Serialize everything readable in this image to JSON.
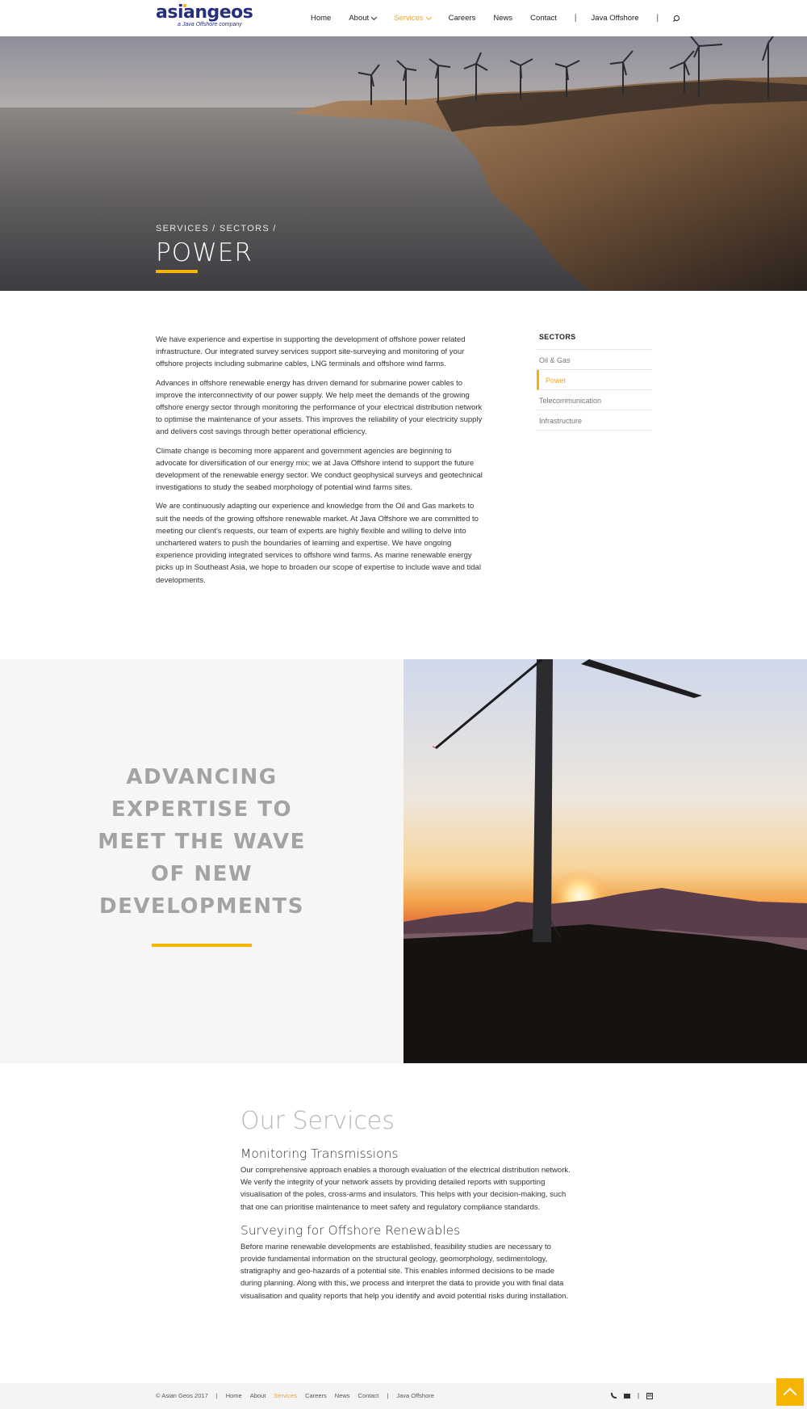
{
  "brand": {
    "logo_text": "asiangeos",
    "tagline": "a Java Offshore company",
    "accent_color": "#f5b400",
    "brand_color": "#26307a"
  },
  "nav": {
    "items": [
      {
        "label": "Home",
        "dropdown": false,
        "active": false
      },
      {
        "label": "About",
        "dropdown": true,
        "active": false
      },
      {
        "label": "Services",
        "dropdown": true,
        "active": true
      },
      {
        "label": "Careers",
        "dropdown": false,
        "active": false
      },
      {
        "label": "News",
        "dropdown": false,
        "active": false
      },
      {
        "label": "Contact",
        "dropdown": false,
        "active": false
      }
    ],
    "separator": "|",
    "external_label": "Java Offshore",
    "search_icon": "search-icon"
  },
  "hero": {
    "breadcrumb": "SERVICES / SECTORS /",
    "title": "POWER"
  },
  "content": {
    "paragraphs": [
      "We have experience and expertise in supporting the development of offshore power related infrastructure. Our integrated survey services support site-surveying and monitoring of your offshore projects including submarine cables, LNG terminals and offshore wind farms.",
      "Advances in offshore renewable energy has driven demand for submarine power cables to improve the interconnectivity of our power supply. We help meet the demands of the growing offshore energy sector through monitoring the performance of your electrical distribution network to optimise the maintenance of your assets. This improves the reliability of your electricity supply and delivers cost savings through better operational efficiency.",
      "Climate change is becoming more apparent and government agencies are beginning to advocate for diversification of our energy mix; we at Java Offshore intend to support the future development of the renewable energy sector. We conduct geophysical surveys and geotechnical investigations to study the seabed morphology of potential wind farms sites.",
      "We are continuously adapting our experience and knowledge from the Oil and Gas markets to suit the needs of the growing offshore renewable market. At Java Offshore we are committed to meeting our client's requests, our team of experts are highly flexible and willing to delve into unchartered waters to push the boundaries of learning and expertise. We have ongoing experience providing integrated services to offshore wind farms. As marine renewable energy picks up in Southeast Asia, we hope to broaden our scope of expertise to include wave and tidal developments."
    ]
  },
  "sectors": {
    "title": "SECTORS",
    "items": [
      {
        "label": "Oil & Gas",
        "active": false
      },
      {
        "label": "Power",
        "active": true
      },
      {
        "label": "Telecommunication",
        "active": false
      },
      {
        "label": "Infrastructure",
        "active": false
      }
    ]
  },
  "feature": {
    "heading": "ADVANCING EXPERTISE TO MEET THE WAVE OF NEW DEVELOPMENTS"
  },
  "services": {
    "title": "Our Services",
    "items": [
      {
        "heading": "Monitoring Transmissions",
        "text": "Our comprehensive approach enables a thorough evaluation of the electrical distribution network. We verify the integrity of your network assets by providing detailed reports with supporting visualisation of the poles, cross-arms and insulators. This helps with your decision-making, such that one can prioritise maintenance to meet safety and regulatory compliance standards."
      },
      {
        "heading": "Surveying for Offshore Renewables",
        "text": "Before marine renewable developments are established, feasibility studies are necessary to provide fundamental information on the structural geology, geomorphology, sedimentology, stratigraphy and geo-hazards of a potential site. This enables informed decisions to be made during planning. Along with this, we process and interpret the data to provide you with final data visualisation and quality reports that help you identify and avoid potential risks during installation."
      }
    ]
  },
  "footer": {
    "copyright": "© Asian Geos 2017",
    "separator": "|",
    "links": [
      {
        "label": "Home",
        "active": false
      },
      {
        "label": "About",
        "active": false
      },
      {
        "label": "Services",
        "active": true
      },
      {
        "label": "Careers",
        "active": false
      },
      {
        "label": "News",
        "active": false
      },
      {
        "label": "Contact",
        "active": false
      }
    ],
    "external_label": "Java Offshore",
    "icons": [
      "phone-icon",
      "mail-icon",
      "linkedin-icon"
    ],
    "linkedin_glyph": "in"
  }
}
